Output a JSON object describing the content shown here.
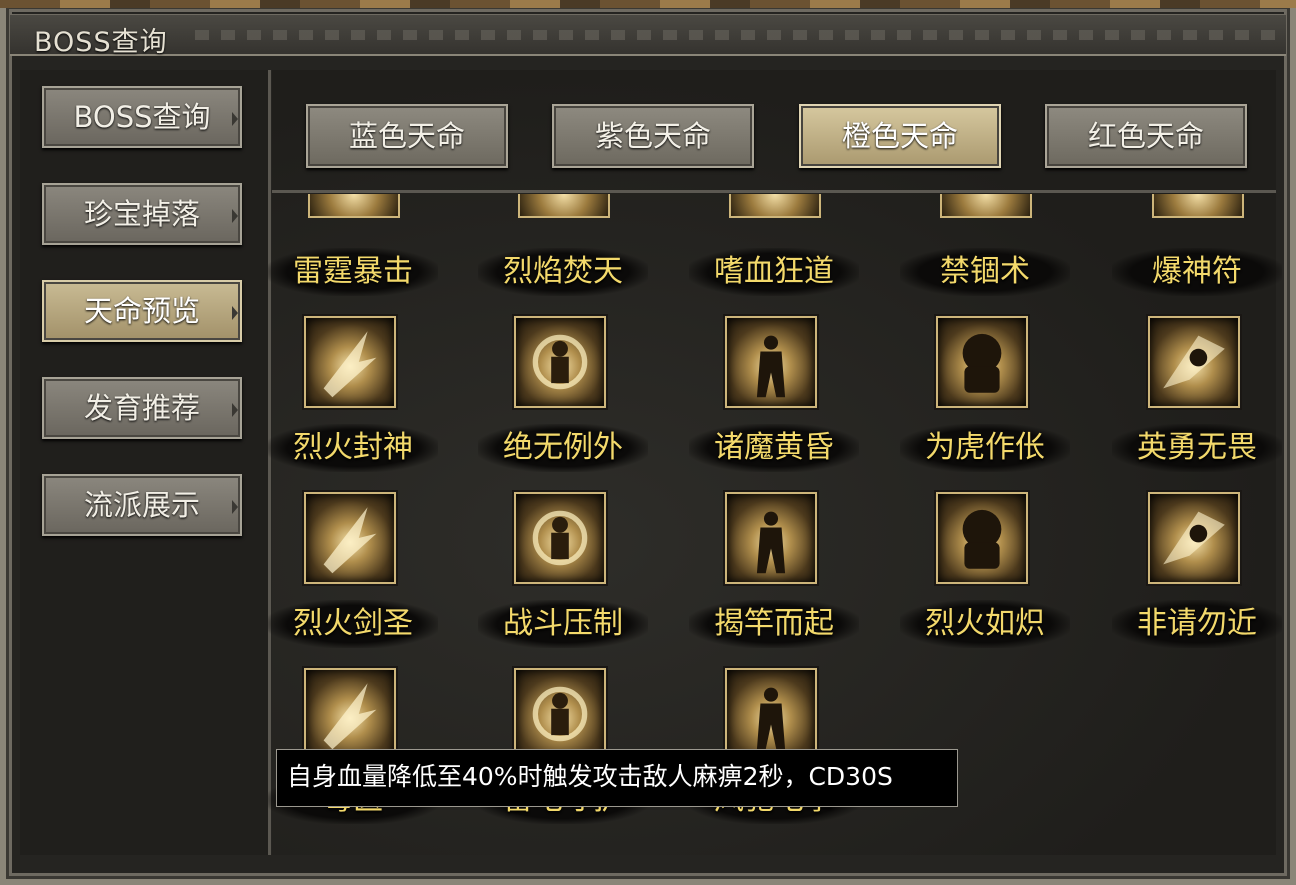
{
  "window": {
    "title": "BOSS查询"
  },
  "sidebar": {
    "items": [
      {
        "label": "BOSS查询",
        "active": false
      },
      {
        "label": "珍宝掉落",
        "active": false
      },
      {
        "label": "天命预览",
        "active": true
      },
      {
        "label": "发育推荐",
        "active": false
      },
      {
        "label": "流派展示",
        "active": false
      }
    ]
  },
  "tabs": [
    {
      "label": "蓝色天命",
      "active": false
    },
    {
      "label": "紫色天命",
      "active": false
    },
    {
      "label": "橙色天命",
      "active": true
    },
    {
      "label": "红色天命",
      "active": false
    }
  ],
  "skills": [
    {
      "name": "雷霆暴击",
      "icon": "lightning-crit-icon"
    },
    {
      "name": "烈焰焚天",
      "icon": "flame-sky-icon"
    },
    {
      "name": "嗜血狂道",
      "icon": "bloodlust-icon"
    },
    {
      "name": "禁锢术",
      "icon": "imprison-icon"
    },
    {
      "name": "爆神符",
      "icon": "burst-talisman-icon"
    },
    {
      "name": "烈火封神",
      "icon": "fire-feather-icon"
    },
    {
      "name": "绝无例外",
      "icon": "vortex-figure-icon"
    },
    {
      "name": "诸魔黄昏",
      "icon": "demon-twilight-icon"
    },
    {
      "name": "为虎作伥",
      "icon": "tiger-beast-icon"
    },
    {
      "name": "英勇无畏",
      "icon": "brave-leap-icon"
    },
    {
      "name": "烈火剑圣",
      "icon": "sword-saint-icon"
    },
    {
      "name": "战斗压制",
      "icon": "battle-suppress-icon"
    },
    {
      "name": "揭竿而起",
      "icon": "uprising-icon"
    },
    {
      "name": "烈火如炽",
      "icon": "blazing-fire-icon"
    },
    {
      "name": "非请勿近",
      "icon": "keep-away-icon"
    },
    {
      "name": "毒医",
      "icon": "poison-doctor-icon"
    },
    {
      "name": "雷电守护",
      "icon": "thunder-guard-icon"
    },
    {
      "name": "风驰电掣",
      "icon": "wind-lightning-icon"
    }
  ],
  "tooltip": {
    "text": "自身血量降低至40%时触发攻击敌人麻痹2秒，CD30S"
  },
  "colors": {
    "skill_name": "#f3d96b",
    "active_button": "#c9bb94",
    "button": "#7d796f"
  }
}
